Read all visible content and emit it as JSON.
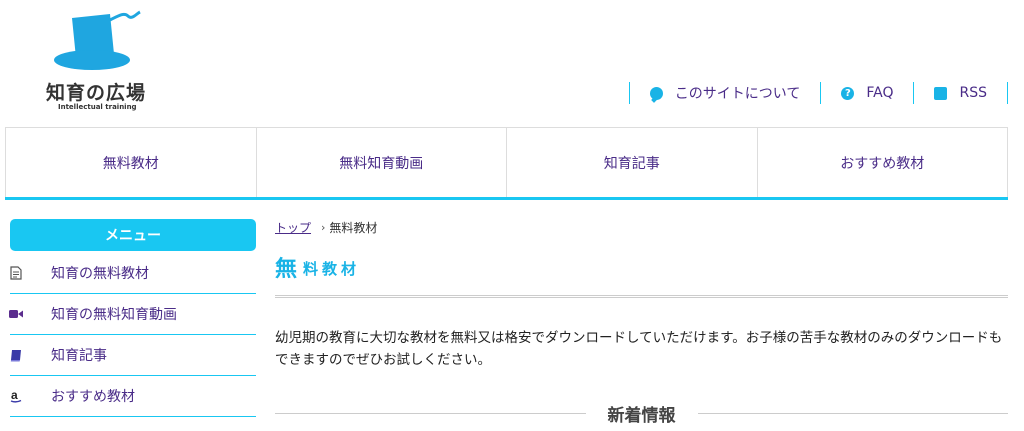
{
  "site": {
    "logo_title": "知育の広場",
    "logo_subtitle": "Intellectual training"
  },
  "top_links": [
    {
      "label": "このサイトについて",
      "icon": "chat-bubble-icon"
    },
    {
      "label": "FAQ",
      "icon": "question-icon"
    },
    {
      "label": "RSS",
      "icon": "rss-icon"
    }
  ],
  "nav": [
    {
      "label": "無料教材"
    },
    {
      "label": "無料知育動画"
    },
    {
      "label": "知育記事"
    },
    {
      "label": "おすすめ教材"
    }
  ],
  "sidebar": {
    "header": "メニュー",
    "items": [
      {
        "label": "知育の無料教材",
        "icon": "document-icon"
      },
      {
        "label": "知育の無料知育動画",
        "icon": "video-camera-icon"
      },
      {
        "label": "知育記事",
        "icon": "book-icon"
      },
      {
        "label": "おすすめ教材",
        "icon": "amazon-icon"
      }
    ]
  },
  "breadcrumb": {
    "home": "トップ",
    "separator": "›",
    "current": "無料教材"
  },
  "page": {
    "title_first": "無",
    "title_rest": "料教材",
    "description": "幼児期の教育に大切な教材を無料又は格安でダウンロードしていただけます。お子様の苦手な教材のみのダウンロードもできますのでぜひお試しください。",
    "news_heading": "新着情報"
  },
  "colors": {
    "accent": "#19c7f2",
    "link": "#4a2c88",
    "icon_video": "#5b2d8e"
  }
}
